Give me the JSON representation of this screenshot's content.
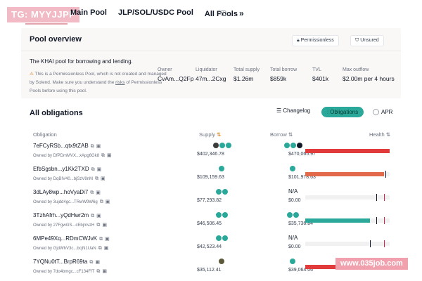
{
  "watermark_top": "TG: MYYJJPP",
  "tabs": [
    {
      "label": "Main Pool"
    },
    {
      "label": "JLP/SOL/USDC Pool"
    },
    {
      "label": "All Pools"
    }
  ],
  "tab_chevron": "»",
  "overview": {
    "title": "Pool overview",
    "badge_permissionless": "Permissionless",
    "badge_unsured": "Unsured",
    "description": "The KHAI pool for borrowing and lending.",
    "warning_text": "This is a Permissionless Pool, which is not created and managed by Solend. Make sure you understand the",
    "warning_link": "risks",
    "warning_suffix": "of Permissionless Pools before using this pool.",
    "stats": [
      {
        "label": "Owner",
        "value": "CvAm...Q2Fp"
      },
      {
        "label": "Liquidator",
        "value": "47m...2Cxg"
      },
      {
        "label": "Total supply",
        "value": "$1.26m"
      },
      {
        "label": "Total borrow",
        "value": "$859k"
      },
      {
        "label": "TVL",
        "value": "$401k"
      },
      {
        "label": "Max outflow",
        "value": "$2.00m per 4 hours"
      }
    ]
  },
  "obligations": {
    "title": "All obligations",
    "changelog": "Changelog",
    "obligations_toggle": "Obligations",
    "apr": "APR",
    "headers": {
      "obligation": "Obligation",
      "supply": "Supply",
      "borrow": "Borrow",
      "health": "Health"
    },
    "rows": [
      {
        "address": "7eFCyRSb...qtx9tZAB",
        "owner": "Owned by DfPDmMVX...xApg6Gk8",
        "supply_amount": "$402,346.78",
        "borrow_amount": "$470,065.97",
        "borrow_na": "",
        "health": 1.0,
        "health_color": "#e23b3b",
        "marks": []
      },
      {
        "address": "EfbSgsbn...y1Kk2TXD",
        "owner": "Owned by DqBIV40...bjSzV8nM",
        "supply_amount": "$109,159.63",
        "borrow_amount": "$101,978.63",
        "borrow_na": "",
        "health": 0.93,
        "health_color": "#e26a4a",
        "marks": [
          0.95
        ]
      },
      {
        "address": "3dLAy8wp...hoVyaDi7",
        "owner": "Owned by 3ujdd4gc...TRwW9W6g",
        "supply_amount": "$77,293.82",
        "borrow_amount": "$0.00",
        "borrow_na": "N/A",
        "health": 0.0,
        "health_color": "#cfcfcf",
        "marks": [
          0.84,
          0.93
        ]
      },
      {
        "address": "3TzhAfrh...yQdHwr2m",
        "owner": "Owned by 27FgwGS...cEbjmvzH",
        "supply_amount": "$46,506.45",
        "borrow_amount": "$35,736.84",
        "borrow_na": "",
        "health": 0.77,
        "health_color": "#2aa99a",
        "marks": [
          0.84,
          0.93
        ]
      },
      {
        "address": "6MPe49Xq...RDmCWJvK",
        "owner": "Owned by GjdWhV3c...bcjN1UaN",
        "supply_amount": "$42,523.44",
        "borrow_amount": "$0.00",
        "borrow_na": "N/A",
        "health": 0.0,
        "health_color": "#cfcfcf",
        "marks": [
          0.77,
          0.93
        ]
      },
      {
        "address": "7YQNu0tT...BrpR69ta",
        "owner": "Owned by 7do4bmgc...cF134FfT",
        "supply_amount": "$35,112.41",
        "borrow_amount": "$39,064.06",
        "borrow_na": "",
        "health": 1.0,
        "health_color": "#e23b3b",
        "marks": []
      }
    ]
  },
  "watermark_site": "www.035job.com",
  "colors": {
    "accent": "#2aa99a",
    "danger": "#e23b3b",
    "warning": "#e26a4a"
  }
}
